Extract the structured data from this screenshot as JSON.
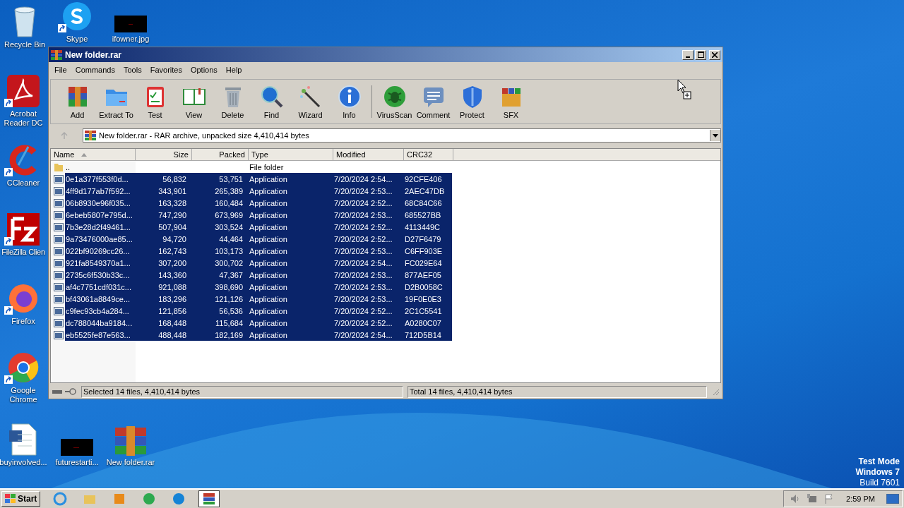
{
  "desktop_icons": [
    {
      "label": "Recycle Bin",
      "shortcut": false
    },
    {
      "label": "Skype",
      "shortcut": true
    },
    {
      "label": "ifowner.jpg",
      "shortcut": false
    },
    {
      "label": "Acrobat Reader DC",
      "shortcut": true
    },
    {
      "label": "CCleaner",
      "shortcut": true
    },
    {
      "label": "FileZilla Clien",
      "shortcut": true
    },
    {
      "label": "Firefox",
      "shortcut": true
    },
    {
      "label": "Google Chrome",
      "shortcut": true
    },
    {
      "label": "buyinvolved...",
      "shortcut": false
    },
    {
      "label": "futurestarti...",
      "shortcut": false
    },
    {
      "label": "New folder.rar",
      "shortcut": false
    }
  ],
  "window": {
    "title": "New folder.rar",
    "menu": [
      "File",
      "Commands",
      "Tools",
      "Favorites",
      "Options",
      "Help"
    ],
    "toolbar": {
      "groups": [
        {
          "buttons": [
            "Add",
            "Extract To",
            "Test",
            "View",
            "Delete",
            "Find",
            "Wizard",
            "Info"
          ]
        },
        {
          "buttons": [
            "VirusScan",
            "Comment",
            "Protect",
            "SFX"
          ]
        }
      ]
    },
    "address": "New folder.rar - RAR archive, unpacked size 4,410,414 bytes",
    "table": {
      "columns": [
        {
          "label": "Name",
          "sorted": true
        },
        {
          "label": "Size",
          "sorted": false
        },
        {
          "label": "Packed",
          "sorted": false
        },
        {
          "label": "Type",
          "sorted": false
        },
        {
          "label": "Modified",
          "sorted": false
        },
        {
          "label": "CRC32",
          "sorted": false
        }
      ],
      "rows": [
        {
          "kind": "folder",
          "name": "..",
          "size": "",
          "packed": "",
          "type": "File folder",
          "modified": "",
          "crc": "",
          "selected": false
        },
        {
          "kind": "file",
          "name": "0e1a377f553f0d...",
          "size": "56,832",
          "packed": "53,751",
          "type": "Application",
          "modified": "7/20/2024 2:54...",
          "crc": "92CFE406",
          "selected": true
        },
        {
          "kind": "file",
          "name": "4ff9d177ab7f592...",
          "size": "343,901",
          "packed": "265,389",
          "type": "Application",
          "modified": "7/20/2024 2:53...",
          "crc": "2AEC47DB",
          "selected": true
        },
        {
          "kind": "file",
          "name": "06b8930e96f035...",
          "size": "163,328",
          "packed": "160,484",
          "type": "Application",
          "modified": "7/20/2024 2:52...",
          "crc": "68C84C66",
          "selected": true
        },
        {
          "kind": "file",
          "name": "6ebeb5807e795d...",
          "size": "747,290",
          "packed": "673,969",
          "type": "Application",
          "modified": "7/20/2024 2:53...",
          "crc": "685527BB",
          "selected": true
        },
        {
          "kind": "file",
          "name": "7b3e28d2f49461...",
          "size": "507,904",
          "packed": "303,524",
          "type": "Application",
          "modified": "7/20/2024 2:52...",
          "crc": "4113449C",
          "selected": true
        },
        {
          "kind": "file",
          "name": "9a73476000ae85...",
          "size": "94,720",
          "packed": "44,464",
          "type": "Application",
          "modified": "7/20/2024 2:52...",
          "crc": "D27F6479",
          "selected": true
        },
        {
          "kind": "file",
          "name": "022bf90269cc26...",
          "size": "162,743",
          "packed": "103,173",
          "type": "Application",
          "modified": "7/20/2024 2:53...",
          "crc": "C6FF903E",
          "selected": true
        },
        {
          "kind": "file",
          "name": "921fa8549370a1...",
          "size": "307,200",
          "packed": "300,702",
          "type": "Application",
          "modified": "7/20/2024 2:54...",
          "crc": "FC029E64",
          "selected": true
        },
        {
          "kind": "file",
          "name": "2735c6f530b33c...",
          "size": "143,360",
          "packed": "47,367",
          "type": "Application",
          "modified": "7/20/2024 2:53...",
          "crc": "877AEF05",
          "selected": true
        },
        {
          "kind": "file",
          "name": "af4c7751cdf031c...",
          "size": "921,088",
          "packed": "398,690",
          "type": "Application",
          "modified": "7/20/2024 2:53...",
          "crc": "D2B0058C",
          "selected": true
        },
        {
          "kind": "file",
          "name": "bf43061a8849ce...",
          "size": "183,296",
          "packed": "121,126",
          "type": "Application",
          "modified": "7/20/2024 2:53...",
          "crc": "19F0E0E3",
          "selected": true
        },
        {
          "kind": "file",
          "name": "c9fec93cb4a284...",
          "size": "121,856",
          "packed": "56,536",
          "type": "Application",
          "modified": "7/20/2024 2:52...",
          "crc": "2C1C5541",
          "selected": true
        },
        {
          "kind": "file",
          "name": "dc788044ba9184...",
          "size": "168,448",
          "packed": "115,684",
          "type": "Application",
          "modified": "7/20/2024 2:52...",
          "crc": "A0280C07",
          "selected": true
        },
        {
          "kind": "file",
          "name": "eb5525fe87e563...",
          "size": "488,448",
          "packed": "182,169",
          "type": "Application",
          "modified": "7/20/2024 2:54...",
          "crc": "712D5B14",
          "selected": true
        }
      ]
    },
    "status_left": "Selected 14 files, 4,410,414 bytes",
    "status_right": "Total 14 files, 4,410,414 bytes"
  },
  "os_notice": [
    "Test Mode",
    "Windows 7",
    "Build 7601"
  ],
  "taskbar": {
    "start": "Start",
    "apps": [
      {
        "selected": false
      },
      {
        "selected": false
      },
      {
        "selected": false
      },
      {
        "selected": false
      },
      {
        "selected": false
      },
      {
        "selected": true
      }
    ],
    "clock": "2:59 PM"
  }
}
